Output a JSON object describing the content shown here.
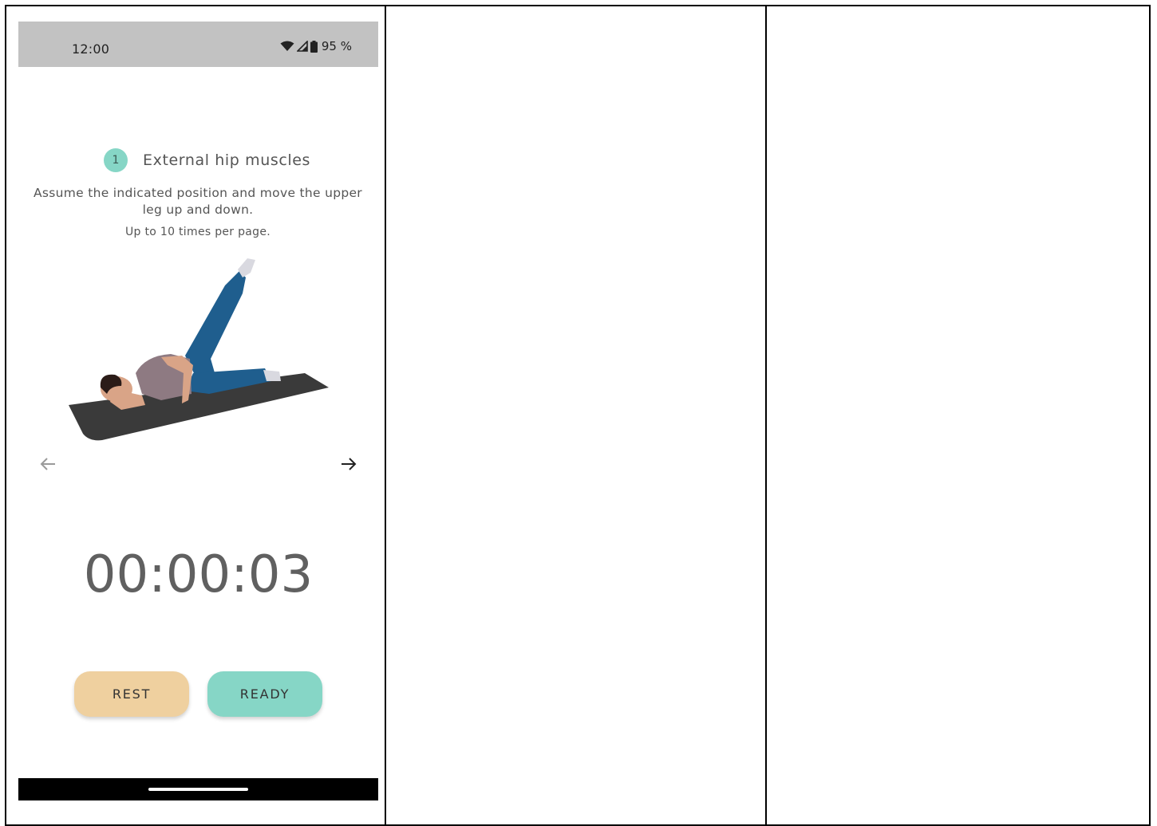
{
  "status_bar": {
    "time": "12:00",
    "battery": "95 %",
    "icons": [
      "wifi-icon",
      "cell-signal-icon",
      "battery-icon"
    ]
  },
  "exercise": {
    "step_number": "1",
    "title": "External hip muscles",
    "instruction": "Assume the indicated position and move the upper leg up and down.",
    "repetitions": "Up to 10 times per page.",
    "image": "woman-side-lying-leg-raise-on-mat"
  },
  "navigation": {
    "prev_icon": "arrow-left-icon",
    "next_icon": "arrow-right-icon"
  },
  "timer": {
    "value": "00:00:03"
  },
  "buttons": {
    "rest_label": "REST",
    "ready_label": "READY"
  },
  "colors": {
    "accent_teal": "#86d6c6",
    "rest_yellow": "#efd09f",
    "status_bar_gray": "#c2c2c2"
  }
}
